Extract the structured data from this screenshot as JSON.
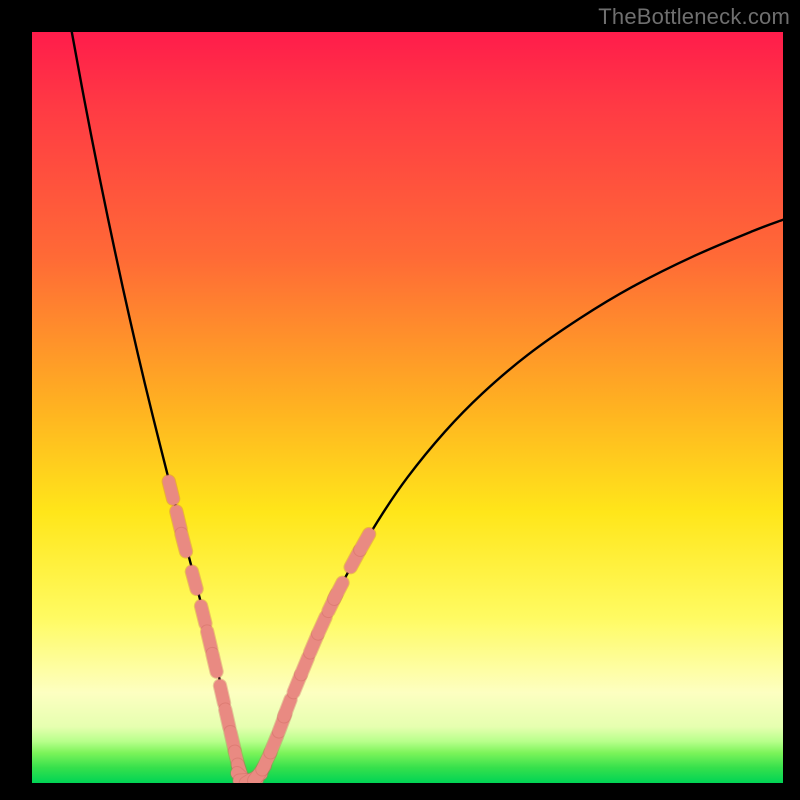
{
  "watermark": "TheBottleneck.com",
  "colors": {
    "frame": "#000000",
    "curve": "#000000",
    "marker_fill": "#e98a82",
    "marker_stroke": "#c9645a"
  },
  "chart_data": {
    "type": "line",
    "title": "",
    "xlabel": "",
    "ylabel": "",
    "xlim": [
      0,
      100
    ],
    "ylim": [
      0,
      100
    ],
    "grid": false,
    "legend": false,
    "note": "V-shaped bottleneck curve; x is a normalized component-ratio axis, y is bottleneck percentage. No axis ticks or labels are rendered in the image, so values are inferred from pixel positions.",
    "series": [
      {
        "name": "left-branch",
        "x": [
          5.3,
          7,
          9,
          11,
          13,
          15,
          17,
          19,
          20.5,
          22,
          23.5,
          24.7,
          25.8,
          26.8,
          27.6,
          28.3
        ],
        "y": [
          100,
          90.8,
          80.6,
          71.0,
          61.9,
          53.3,
          45.2,
          37.3,
          31.6,
          25.9,
          20.0,
          15.0,
          10.1,
          5.3,
          1.3,
          0.3
        ]
      },
      {
        "name": "right-branch",
        "x": [
          28.3,
          30,
          32,
          34,
          36,
          38.7,
          42,
          46,
          50,
          55,
          60,
          66,
          73,
          80,
          88,
          96,
          100
        ],
        "y": [
          0.3,
          1.1,
          4.5,
          9.6,
          14.8,
          21.1,
          27.9,
          34.8,
          40.7,
          46.8,
          51.9,
          57.0,
          61.9,
          66.1,
          70.1,
          73.5,
          75.0
        ]
      }
    ],
    "markers": {
      "name": "highlighted-points",
      "shape": "rounded-capsule",
      "points": [
        {
          "x": 18.5,
          "y": 39.0
        },
        {
          "x": 19.5,
          "y": 35.0
        },
        {
          "x": 20.2,
          "y": 32.0
        },
        {
          "x": 21.6,
          "y": 27.0
        },
        {
          "x": 22.8,
          "y": 22.4
        },
        {
          "x": 23.6,
          "y": 19.0
        },
        {
          "x": 24.3,
          "y": 16.0
        },
        {
          "x": 25.3,
          "y": 11.8
        },
        {
          "x": 26.0,
          "y": 8.6
        },
        {
          "x": 26.7,
          "y": 5.6
        },
        {
          "x": 27.3,
          "y": 3.0
        },
        {
          "x": 27.8,
          "y": 1.3
        },
        {
          "x": 28.2,
          "y": 0.5
        },
        {
          "x": 28.8,
          "y": 0.4
        },
        {
          "x": 29.5,
          "y": 0.6
        },
        {
          "x": 30.3,
          "y": 1.3
        },
        {
          "x": 31.2,
          "y": 2.9
        },
        {
          "x": 32.2,
          "y": 5.2
        },
        {
          "x": 33.3,
          "y": 8.0
        },
        {
          "x": 34.0,
          "y": 10.0
        },
        {
          "x": 35.3,
          "y": 13.2
        },
        {
          "x": 36.3,
          "y": 15.6
        },
        {
          "x": 37.5,
          "y": 18.5
        },
        {
          "x": 38.6,
          "y": 21.0
        },
        {
          "x": 40.0,
          "y": 24.0
        },
        {
          "x": 40.8,
          "y": 25.6
        },
        {
          "x": 43.0,
          "y": 29.8
        },
        {
          "x": 44.3,
          "y": 32.1
        }
      ]
    }
  }
}
